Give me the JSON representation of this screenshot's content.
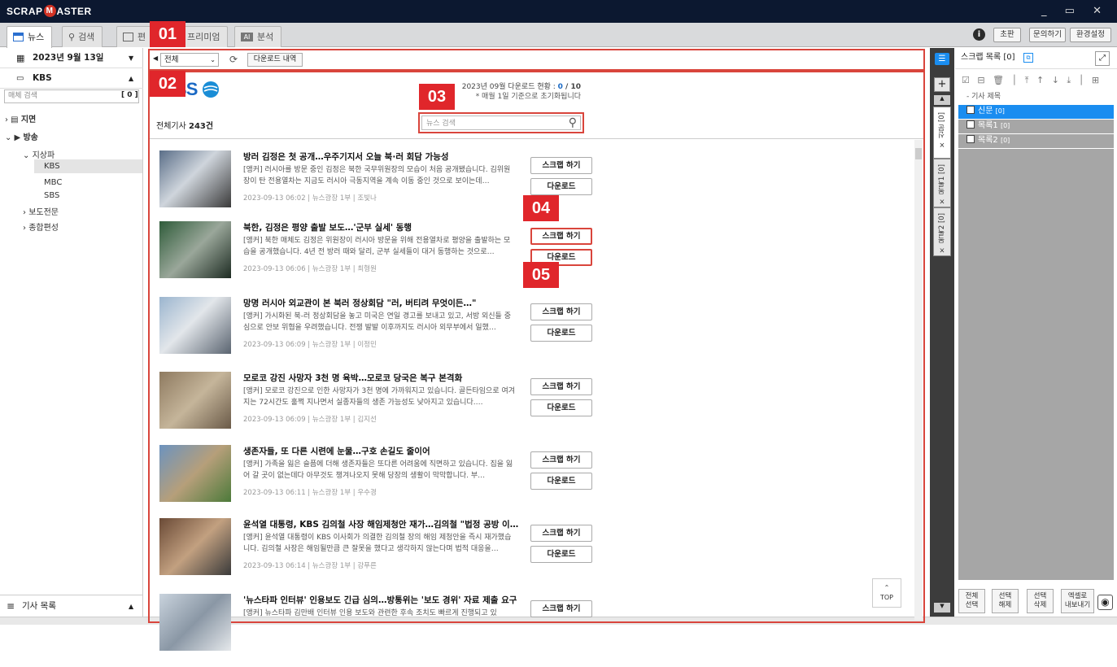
{
  "app": {
    "logo_a": "SCRAP",
    "logo_m": "M",
    "logo_b": "ASTER",
    "win_controls": "_ ▭ ✕"
  },
  "tabs": [
    {
      "label": "뉴스",
      "active": true
    },
    {
      "label": "검색"
    },
    {
      "label": "편"
    },
    {
      "label": "프리미엄"
    },
    {
      "label": "분석"
    }
  ],
  "header_buttons": {
    "info": "i",
    "edition": "초판",
    "inquiry": "문의하기",
    "settings": "환경설정"
  },
  "left": {
    "date": "2023년 9월 13일",
    "source": "KBS",
    "media_search_placeholder": "매체 검색",
    "media_count": "[ 0 ]",
    "tree": {
      "paper": "지면",
      "broadcast": "방송",
      "terrestrial": "지상파",
      "kbs": "KBS",
      "mbc": "MBC",
      "sbs": "SBS",
      "news_channel": "보도전문",
      "general": "종합편성"
    },
    "article_list": "기사 목록"
  },
  "toolbar": {
    "filter": "전체",
    "download_history": "다운로드 내역"
  },
  "main": {
    "logo": "KBS",
    "dl_status_prefix": "2023년 09월 다운로드 현황 : ",
    "dl_used": "0",
    "dl_total": " / 10",
    "dl_note": "* 매월 1일 기준으로 초기화됩니다",
    "total_label": "전체기사 ",
    "total_count": "243건",
    "search_placeholder": "뉴스 검색",
    "scrap_label": "스크랩 하기",
    "download_label": "다운로드",
    "top_label": "TOP"
  },
  "articles": [
    {
      "title": "방러 김정은 첫 공개…우주기지서 오늘 북·러 회담 가능성",
      "desc": "[앵커] 러시아를 방문 중인 김정은 북한 국무위원장의 모습이 처음 공개됐습니다. 김위원장이 탄 전용열차는 지금도 러시아 극동지역을 계속 이동 중인 것으로 보이는데…",
      "meta": "2023-09-13 06:02 | 뉴스광장 1부 | 조빛나"
    },
    {
      "title": "북한, 김정은 평양 출발 보도…'군부 실세' 동행",
      "desc": "[앵커] 북한 매체도 김정은 위원장이 러시아 방문을 위해 전용열차로 평양을 출발하는 모습을 공개했습니다. 4년 전 방러 때와 달리, 군부 실세들이 대거 동행하는 것으로…",
      "meta": "2023-09-13 06:06 | 뉴스광장 1부 | 최형원"
    },
    {
      "title": "망명 러시아 외교관이 본 북러 정상회담 \"러, 버티려 무엇이든…\"",
      "desc": "[앵커] 가시화된 북-러 정상회담을 놓고 미국은 연일 경고를 보내고 있고, 서방 외신들 중심으로 안보 위협을 우려했습니다. 전쟁 발발 이후까지도 러시아 외무부에서 일했…",
      "meta": "2023-09-13 06:09 | 뉴스광장 1부 | 이정민"
    },
    {
      "title": "모로코 강진 사망자 3천 명 육박…모로코 당국은 복구 본격화",
      "desc": "[앵커] 모로코 강진으로 인한 사망자가 3천 명에 가까워지고 있습니다. 골든타임으로 여겨지는 72시간도 훌쩍 지나면서 실종자들의 생존 가능성도 낮아지고 있습니다.…",
      "meta": "2023-09-13 06:09 | 뉴스광장 1부 | 김지선"
    },
    {
      "title": "생존자들, 또 다른 시련에 눈물…구호 손길도 줄이어",
      "desc": "[앵커] 가족을 잃은 슬픔에 더해 생존자들은 또다른 어려움에 직면하고 있습니다. 집을 잃어 갈 곳이 없는데다 아무것도 챙겨나오지 못해 당장의 생활이 막막합니다. 부…",
      "meta": "2023-09-13 06:11 | 뉴스광장 1부 | 우수경"
    },
    {
      "title": "윤석열 대통령, KBS 김의철 사장 해임제청안 재가…김의철 \"법정 공방 이…",
      "desc": "[앵커] 윤석열 대통령이 KBS 이사회가 의결한 김의철 장의 해임 제청안을 즉시 재가했습니다. 김의철 사장은 해임될만큼 큰 잘못을 했다고 생각하지 않는다며 법적 대응을…",
      "meta": "2023-09-13 06:14 | 뉴스광장 1부 | 강푸른"
    },
    {
      "title": "'뉴스타파 인터뷰' 인용보도 긴급 심의…방통위는 '보도 경위' 자료 제출 요구",
      "desc": "[앵커] 뉴스타파 김만배 인터뷰 인용 보도와 관련한 후속 조치도 빠르게 진행되고 있",
      "meta": ""
    }
  ],
  "annotations": [
    "01",
    "02",
    "03",
    "04",
    "05"
  ],
  "right": {
    "title": "스크랩 목록 [0]",
    "col_header": "기사 제목",
    "folders": [
      {
        "name": "신문",
        "count": "[0]",
        "selected": true
      },
      {
        "name": "목록1",
        "count": "[0]"
      },
      {
        "name": "목록2",
        "count": "[0]"
      }
    ],
    "vtabs": [
      "× 신문 [0]",
      "× 목록1 [0]",
      "× 목록2 [0]"
    ],
    "bottom": {
      "select_all": "전체\n선택",
      "release": "선택\n해제",
      "delete": "선택\n삭제",
      "export": "엑셀로\n내보내기"
    }
  },
  "colors": {
    "accent_red": "#d9453c",
    "title_bar": "#0c1830",
    "selected_blue": "#1a8df0",
    "kbs_blue": "#1a69c4"
  }
}
